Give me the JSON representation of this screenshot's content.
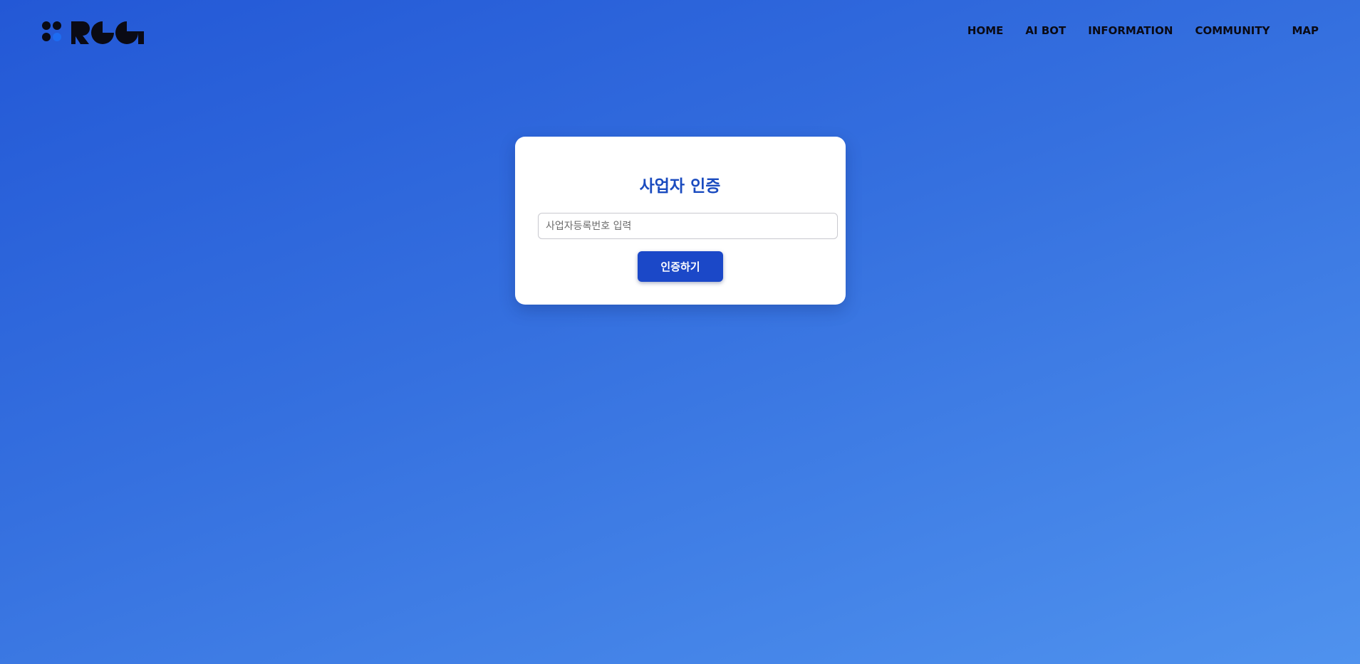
{
  "brand": {
    "logo_icon": "roa-logo-icon",
    "logo_text": "ROA"
  },
  "nav": {
    "items": [
      {
        "label": "HOME"
      },
      {
        "label": "AI BOT"
      },
      {
        "label": "INFORMATION"
      },
      {
        "label": "COMMUNITY"
      },
      {
        "label": "MAP"
      }
    ]
  },
  "verification": {
    "title": "사업자 인증",
    "input_placeholder": "사업자등록번호 입력",
    "input_value": "",
    "submit_label": "인증하기"
  },
  "colors": {
    "background_start": "#2358d6",
    "background_end": "#4f92ee",
    "accent": "#1a4bbf",
    "button": "#1b48c8"
  }
}
